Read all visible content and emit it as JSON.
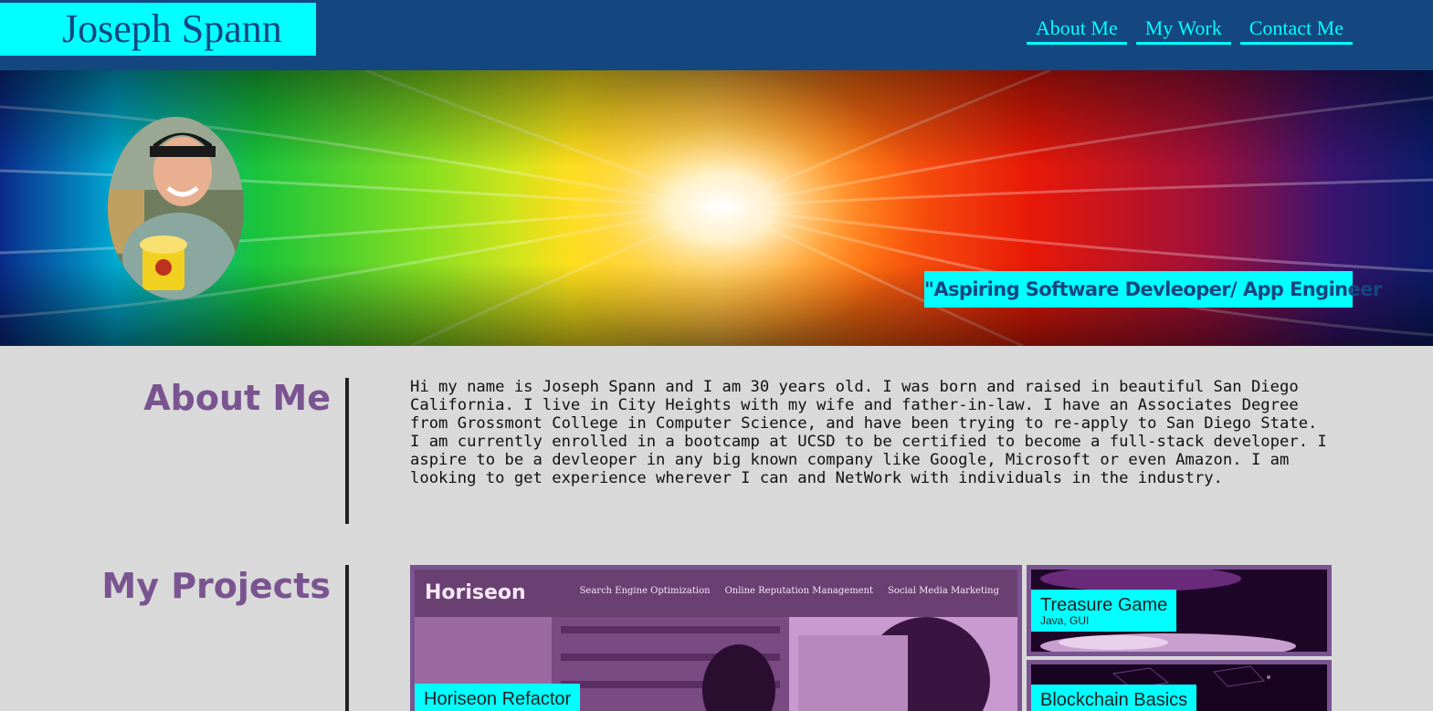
{
  "header": {
    "brand": "Joseph Spann",
    "nav": [
      "About Me",
      "My Work",
      "Contact Me"
    ]
  },
  "hero": {
    "tagline": "\"Aspiring Software Devleoper/ App Engineer"
  },
  "about": {
    "title": "About Me",
    "text": "Hi my name is Joseph Spann and I am 30 years old. I was born and raised in beautiful San Diego California. I live in City Heights with my wife and father-in-law. I have an Associates Degree from Grossmont College in Computer Science, and have been trying to re-apply to San Diego State. I am currently enrolled in a bootcamp at UCSD to be certified to become a full-stack developer. I aspire to be a devleoper in any big known company like Google, Microsoft or even Amazon. I am looking to get experience wherever I can and NetWork with individuals in the industry."
  },
  "projects": {
    "title": "My Projects",
    "main": {
      "label": "Horiseon Refactor",
      "screenshot_logo": "Horiseon",
      "screenshot_links": [
        "Search Engine Optimization",
        "Online Reputation Management",
        "Social Media Marketing"
      ]
    },
    "side": [
      {
        "label": "Treasure Game",
        "sub": "Java, GUI"
      },
      {
        "label": "Blockchain Basics",
        "sub": ""
      }
    ]
  },
  "colors": {
    "header_bg": "#14467f",
    "accent": "#00ffff",
    "section_title": "#7a5490",
    "page_bg": "#d9d9d9"
  }
}
